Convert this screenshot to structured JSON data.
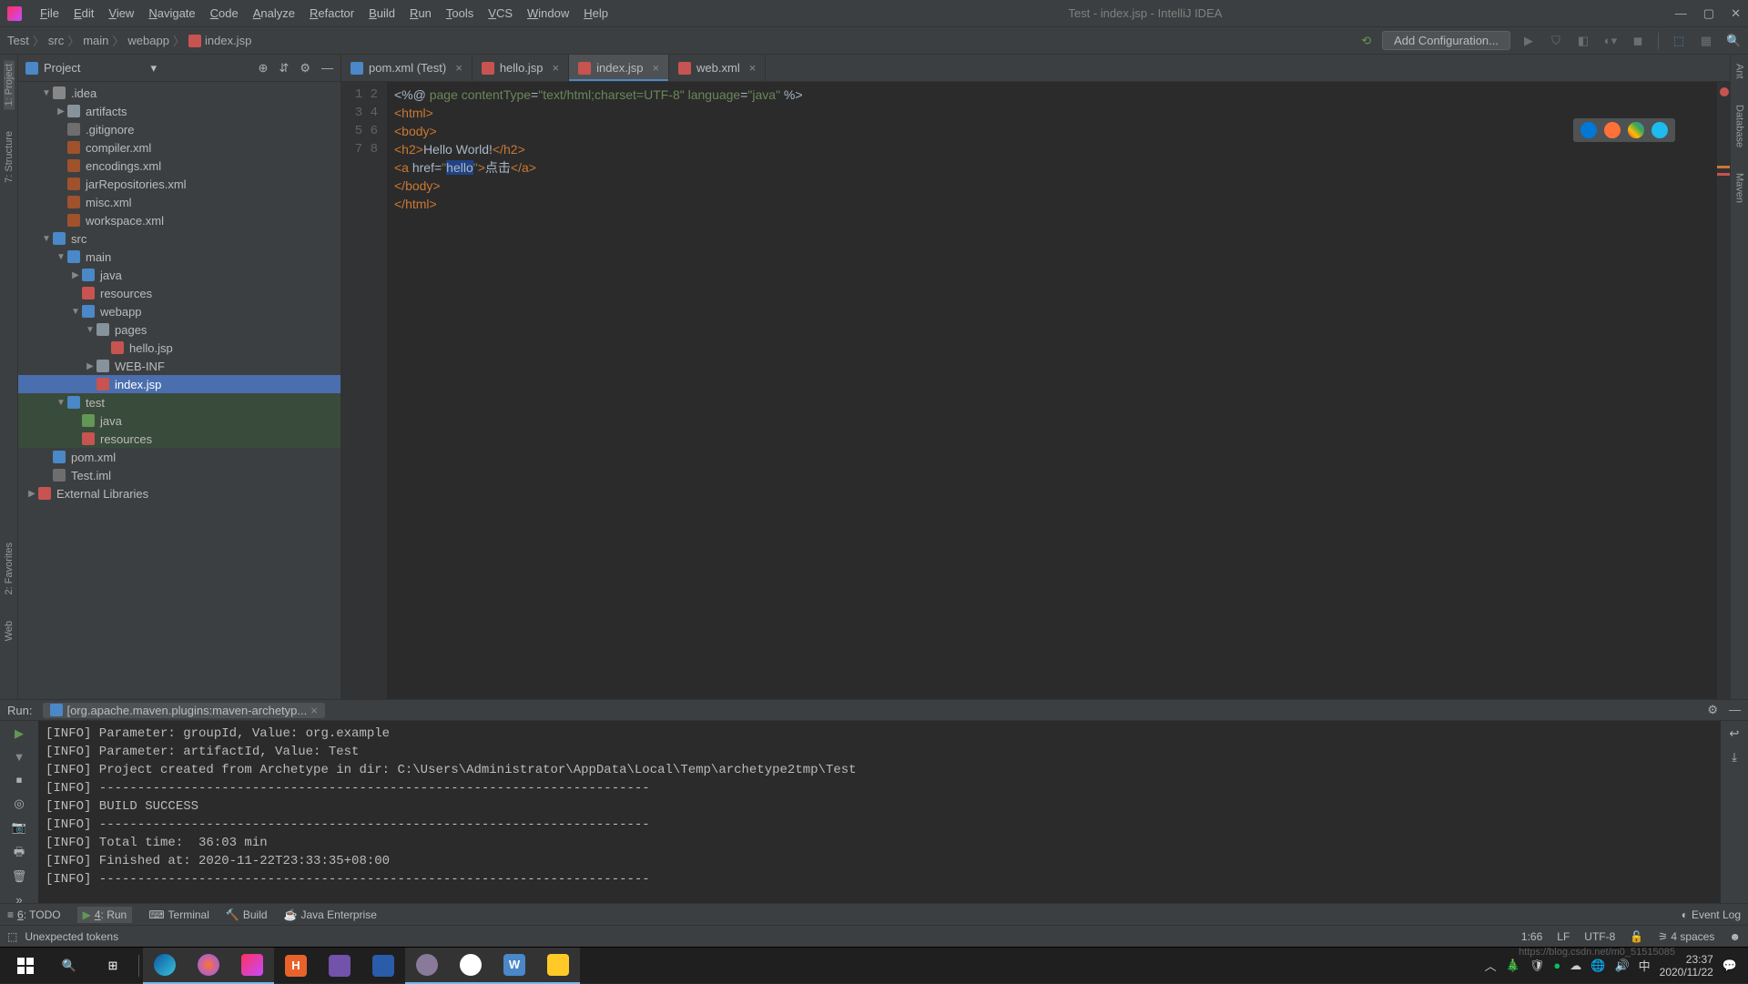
{
  "menubar": [
    "File",
    "Edit",
    "View",
    "Navigate",
    "Code",
    "Analyze",
    "Refactor",
    "Build",
    "Run",
    "Tools",
    "VCS",
    "Window",
    "Help"
  ],
  "window_title": "Test - index.jsp - IntelliJ IDEA",
  "breadcrumb": [
    "Test",
    "src",
    "main",
    "webapp",
    "index.jsp"
  ],
  "add_config": "Add Configuration...",
  "project_header": "Project",
  "tree": [
    {
      "indent": 1,
      "arrow": "▼",
      "icon": "gear",
      "label": ".idea"
    },
    {
      "indent": 2,
      "arrow": "▶",
      "icon": "folder",
      "label": "artifacts"
    },
    {
      "indent": 2,
      "arrow": "",
      "icon": "file",
      "label": ".gitignore"
    },
    {
      "indent": 2,
      "arrow": "",
      "icon": "xml",
      "label": "compiler.xml"
    },
    {
      "indent": 2,
      "arrow": "",
      "icon": "xml",
      "label": "encodings.xml"
    },
    {
      "indent": 2,
      "arrow": "",
      "icon": "xml",
      "label": "jarRepositories.xml"
    },
    {
      "indent": 2,
      "arrow": "",
      "icon": "xml",
      "label": "misc.xml"
    },
    {
      "indent": 2,
      "arrow": "",
      "icon": "xml",
      "label": "workspace.xml"
    },
    {
      "indent": 1,
      "arrow": "▼",
      "icon": "blue",
      "label": "src"
    },
    {
      "indent": 2,
      "arrow": "▼",
      "icon": "blue",
      "label": "main"
    },
    {
      "indent": 3,
      "arrow": "▶",
      "icon": "blue",
      "label": "java"
    },
    {
      "indent": 3,
      "arrow": "",
      "icon": "orange",
      "label": "resources"
    },
    {
      "indent": 3,
      "arrow": "▼",
      "icon": "blue",
      "label": "webapp"
    },
    {
      "indent": 4,
      "arrow": "▼",
      "icon": "folder",
      "label": "pages"
    },
    {
      "indent": 5,
      "arrow": "",
      "icon": "jsp",
      "label": "hello.jsp"
    },
    {
      "indent": 4,
      "arrow": "▶",
      "icon": "folder",
      "label": "WEB-INF"
    },
    {
      "indent": 4,
      "arrow": "",
      "icon": "jsp",
      "label": "index.jsp",
      "selected": true
    },
    {
      "indent": 2,
      "arrow": "▼",
      "icon": "blue",
      "label": "test",
      "tested": true
    },
    {
      "indent": 3,
      "arrow": "",
      "icon": "green",
      "label": "java",
      "tested": true
    },
    {
      "indent": 3,
      "arrow": "",
      "icon": "orange",
      "label": "resources",
      "tested": true
    },
    {
      "indent": 1,
      "arrow": "",
      "icon": "maven",
      "label": "pom.xml"
    },
    {
      "indent": 1,
      "arrow": "",
      "icon": "file",
      "label": "Test.iml"
    },
    {
      "indent": 0,
      "arrow": "▶",
      "icon": "orange",
      "label": "External Libraries"
    }
  ],
  "tabs": [
    {
      "label": "pom.xml (Test)",
      "icon": "#4a88c7"
    },
    {
      "label": "hello.jsp",
      "icon": "#c75450"
    },
    {
      "label": "index.jsp",
      "icon": "#c75450",
      "active": true
    },
    {
      "label": "web.xml",
      "icon": "#c75450"
    }
  ],
  "line_numbers": [
    "1",
    "2",
    "3",
    "4",
    "5",
    "6",
    "7",
    "8"
  ],
  "code_lines": [
    [
      {
        "t": "<%@ ",
        "c": "grey"
      },
      {
        "t": "page contentType",
        "c": "green"
      },
      {
        "t": "=",
        "c": "grey"
      },
      {
        "t": "\"text/html;charset=UTF-8\"",
        "c": "green"
      },
      {
        "t": " language",
        "c": "green"
      },
      {
        "t": "=",
        "c": "grey"
      },
      {
        "t": "\"java\"",
        "c": "green"
      },
      {
        "t": " %>",
        "c": "grey"
      }
    ],
    [
      {
        "t": "<html>",
        "c": "orange"
      }
    ],
    [
      {
        "t": "<body>",
        "c": "orange"
      }
    ],
    [
      {
        "t": "<h2>",
        "c": "orange"
      },
      {
        "t": "Hello World!",
        "c": "grey"
      },
      {
        "t": "</h2>",
        "c": "orange"
      }
    ],
    [
      {
        "t": "<a ",
        "c": "orange"
      },
      {
        "t": "href",
        "c": "grey"
      },
      {
        "t": "=",
        "c": "grey"
      },
      {
        "t": "\"",
        "c": "green"
      },
      {
        "t": "hello",
        "c": "grey",
        "hl": true
      },
      {
        "t": "\"",
        "c": "green"
      },
      {
        "t": ">",
        "c": "orange"
      },
      {
        "t": "点击",
        "c": "grey"
      },
      {
        "t": "</a>",
        "c": "orange"
      }
    ],
    [
      {
        "t": "</body>",
        "c": "orange"
      }
    ],
    [
      {
        "t": "</html>",
        "c": "orange"
      }
    ],
    [
      {
        "t": "",
        "c": "grey"
      }
    ]
  ],
  "run_label": "Run:",
  "run_tab": "[org.apache.maven.plugins:maven-archetyp...",
  "run_output": [
    "[INFO] Parameter: groupId, Value: org.example",
    "[INFO] Parameter: artifactId, Value: Test",
    "[INFO] Project created from Archetype in dir: C:\\Users\\Administrator\\AppData\\Local\\Temp\\archetype2tmp\\Test",
    "[INFO] ------------------------------------------------------------------------",
    "[INFO] BUILD SUCCESS",
    "[INFO] ------------------------------------------------------------------------",
    "[INFO] Total time:  36:03 min",
    "[INFO] Finished at: 2020-11-22T23:33:35+08:00",
    "[INFO] ------------------------------------------------------------------------"
  ],
  "bottom_tools": [
    "6: TODO",
    "4: Run",
    "Terminal",
    "Build",
    "Java Enterprise"
  ],
  "event_log": "Event Log",
  "status_msg": "Unexpected tokens",
  "status_right": [
    "1:66",
    "LF",
    "UTF-8",
    "4 spaces"
  ],
  "left_tools": [
    "1: Project",
    "7: Structure"
  ],
  "left_tools2": [
    "2: Favorites",
    "Web"
  ],
  "right_tools": [
    "Ant",
    "Database",
    "Maven"
  ],
  "tray_time": "23:37",
  "tray_date": "2020/11/22",
  "watermark": "https://blog.csdn.net/m0_51515085"
}
